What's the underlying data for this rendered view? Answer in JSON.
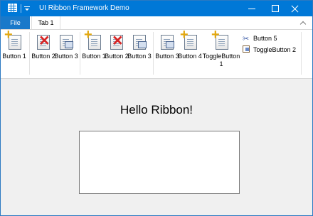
{
  "window": {
    "title": "UI Ribbon Framework Demo",
    "accent_color": "#0078d7",
    "controls": {
      "minimize_icon": "minimize-icon",
      "maximize_icon": "maximize-icon",
      "close_icon": "close-icon"
    }
  },
  "tabs": {
    "file": "File",
    "tab1": "Tab 1"
  },
  "ribbon": {
    "buttons": [
      {
        "label": "Button 1",
        "icon": "add-icon"
      },
      {
        "label": "Button 2",
        "icon": "delete-icon"
      },
      {
        "label": "Button 3",
        "icon": "document-icon"
      },
      {
        "label": "Button 1",
        "icon": "add-icon"
      },
      {
        "label": "Button 2",
        "icon": "delete-icon"
      },
      {
        "label": "Button 3",
        "icon": "document-icon"
      },
      {
        "label": "Button 3",
        "icon": "document-icon"
      },
      {
        "label": "Button 4",
        "icon": "add-icon"
      },
      {
        "label": "ToggleButton 1",
        "icon": "add-icon"
      }
    ],
    "small_buttons": [
      {
        "label": "Button 5",
        "icon": "scissors-icon"
      },
      {
        "label": "ToggleButton 2",
        "icon": "paste-icon"
      }
    ]
  },
  "content": {
    "heading": "Hello Ribbon!",
    "textbox_value": ""
  }
}
